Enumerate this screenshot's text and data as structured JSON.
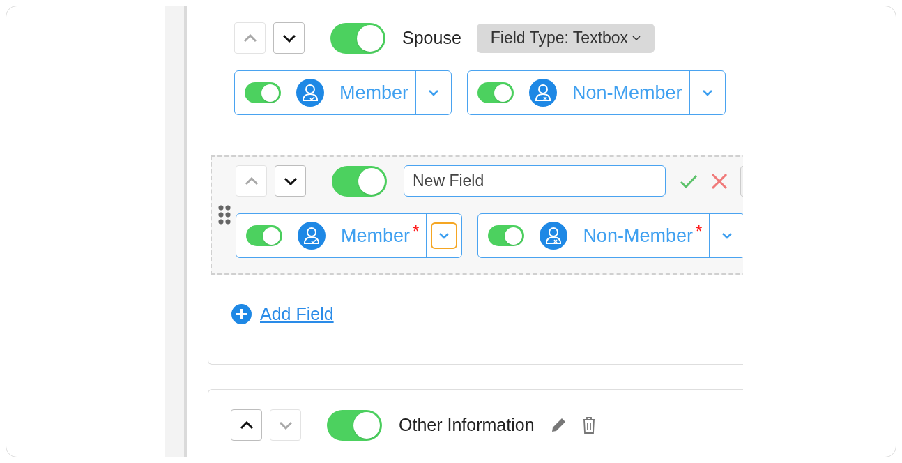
{
  "sections": [
    {
      "kind": "field",
      "up_disabled": true,
      "down_disabled": false,
      "on": true,
      "title": "Spouse",
      "field_type": "Field Type: Textbox",
      "audiences": [
        {
          "label": "Member",
          "kind": "member",
          "on": true,
          "focused": false
        },
        {
          "label": "Non-Member",
          "kind": "non-member",
          "on": true,
          "focused": false
        }
      ]
    },
    {
      "kind": "editing",
      "up_disabled": true,
      "down_disabled": false,
      "on": true,
      "value": "New Field",
      "audiences": [
        {
          "label": "Member",
          "kind": "member",
          "on": true,
          "required_mark": "*",
          "focused": true
        },
        {
          "label": "Non-Member",
          "kind": "non-member",
          "on": true,
          "required_mark": "*",
          "focused": false
        }
      ]
    }
  ],
  "add_field": "Add Field",
  "next_section": {
    "up_disabled": false,
    "down_disabled": true,
    "on": true,
    "title": "Other Information"
  }
}
